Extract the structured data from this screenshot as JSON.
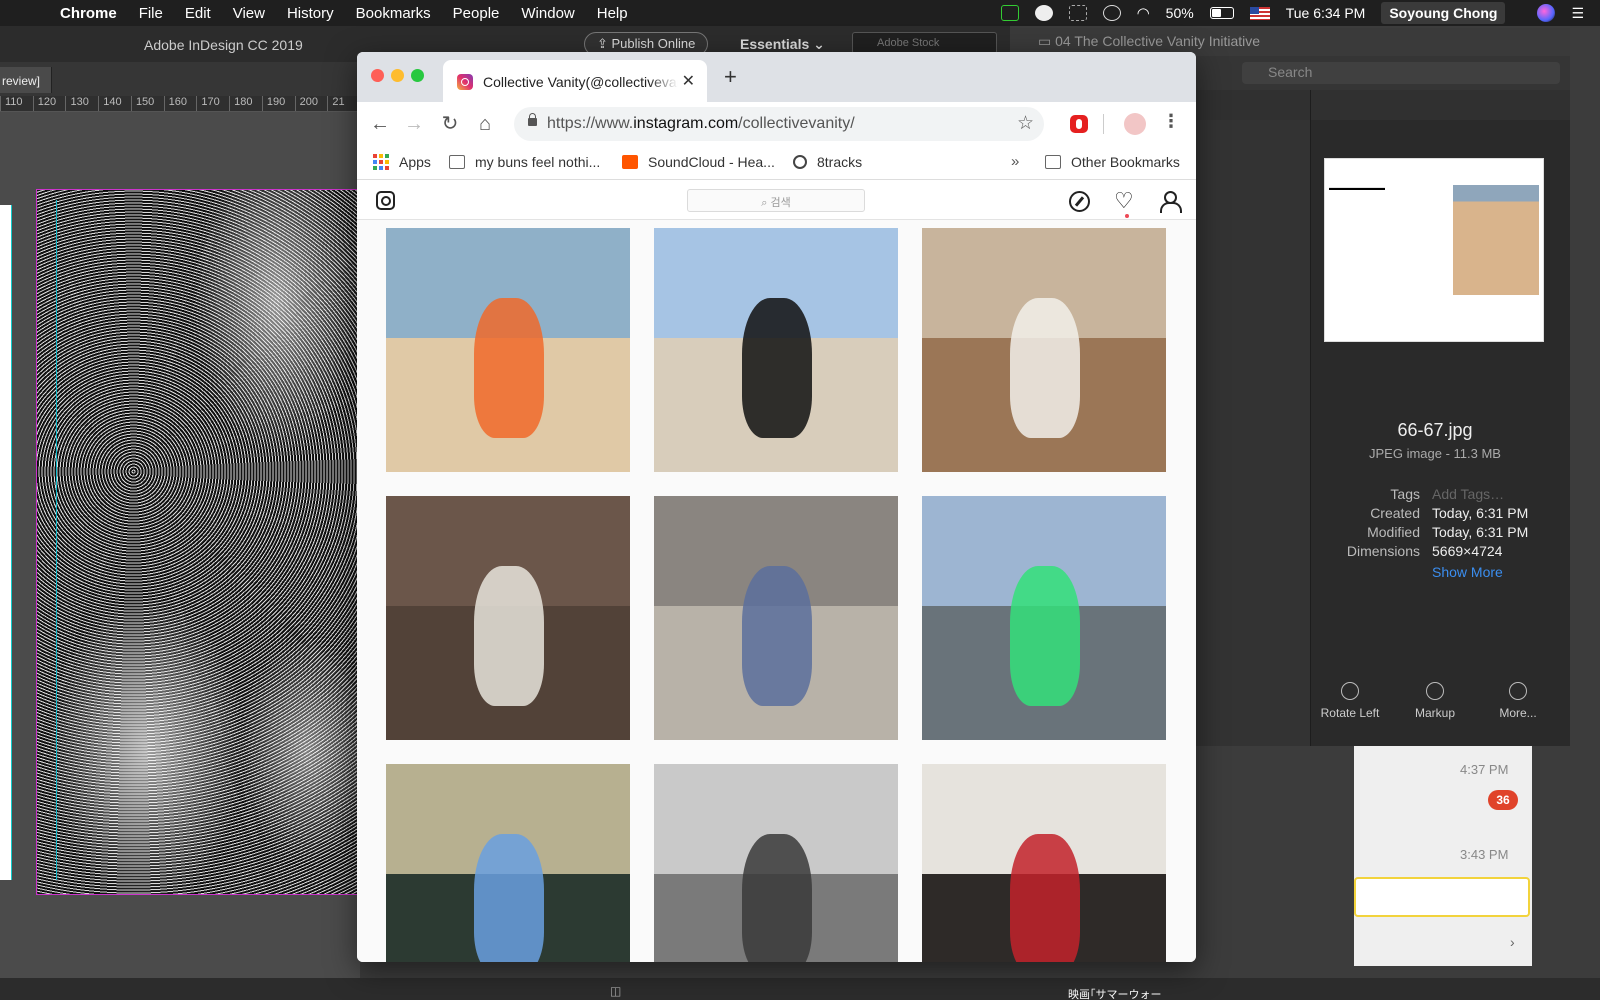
{
  "menubar": {
    "app_name": "Chrome",
    "items": [
      "File",
      "Edit",
      "View",
      "History",
      "Bookmarks",
      "People",
      "Window",
      "Help"
    ],
    "battery": "50%",
    "battery_level": 0.5,
    "clock": "Tue 6:34 PM",
    "user": "Soyoung Chong"
  },
  "indesign": {
    "title": "Adobe InDesign CC 2019",
    "publish_label": "Publish Online",
    "workspace": "Essentials",
    "stock_placeholder": "Adobe Stock",
    "tab_label": "review]",
    "ruler": [
      "110",
      "120",
      "130",
      "140",
      "150",
      "160",
      "170",
      "180",
      "190",
      "200",
      "21"
    ],
    "bottom_caption": "映画｢サマーウォー"
  },
  "finder": {
    "window_title": "04 The Collective Vanity Initiative",
    "search_placeholder": "Search",
    "file_name": "66-67.jpg",
    "file_kind": "JPEG image - 11.3 MB",
    "tags_label": "Tags",
    "tags_placeholder": "Add Tags…",
    "created_label": "Created",
    "created": "Today, 6:31 PM",
    "modified_label": "Modified",
    "modified": "Today, 6:31 PM",
    "dimensions_label": "Dimensions",
    "dimensions": "5669×4724",
    "show_more": "Show More",
    "actions": [
      "Rotate Left",
      "Markup",
      "More..."
    ]
  },
  "messages": {
    "time1": "4:37 PM",
    "badge": "36",
    "time2": "3:43 PM"
  },
  "chrome": {
    "tab_title": "Collective Vanity(@collectivevanity)",
    "url_prefix": "https://www.",
    "url_host": "instagram.com",
    "url_path": "/collectivevanity/",
    "bookmarks": [
      "Apps",
      "my buns feel nothi...",
      "SoundCloud - Hea...",
      "8tracks"
    ],
    "bookmarks_overflow": "»",
    "other_bookmarks": "Other Bookmarks"
  },
  "instagram": {
    "search_placeholder": "검색",
    "photos": [
      {
        "label": "beach-lying",
        "colors": [
          "#8fb0c8",
          "#e0c9a6"
        ],
        "accent": "#f06a2a"
      },
      {
        "label": "beach-kneeling",
        "colors": [
          "#a6c4e4",
          "#d8cdbb"
        ],
        "accent": "#111111"
      },
      {
        "label": "mirror-room",
        "colors": [
          "#c8b49c",
          "#9b7656"
        ],
        "accent": "#f2f0ea"
      },
      {
        "label": "frame-mirror",
        "colors": [
          "#6b564a",
          "#524238"
        ],
        "accent": "#e8e4dc"
      },
      {
        "label": "alley-lying",
        "colors": [
          "#8a8580",
          "#b8b2a8"
        ],
        "accent": "#5b6f9c"
      },
      {
        "label": "surfing",
        "colors": [
          "#9db5d2",
          "#69737a"
        ],
        "accent": "#34e07a"
      },
      {
        "label": "mirror-writing",
        "colors": [
          "#b7b090",
          "#2c3a32"
        ],
        "accent": "#6aa0e0"
      },
      {
        "label": "bw-selfie",
        "colors": [
          "#c9c9c9",
          "#7a7a7a"
        ],
        "accent": "#3a3a3a"
      },
      {
        "label": "red-sweater",
        "colors": [
          "#e6e3dd",
          "#2e2a28"
        ],
        "accent": "#c2222a"
      }
    ]
  }
}
